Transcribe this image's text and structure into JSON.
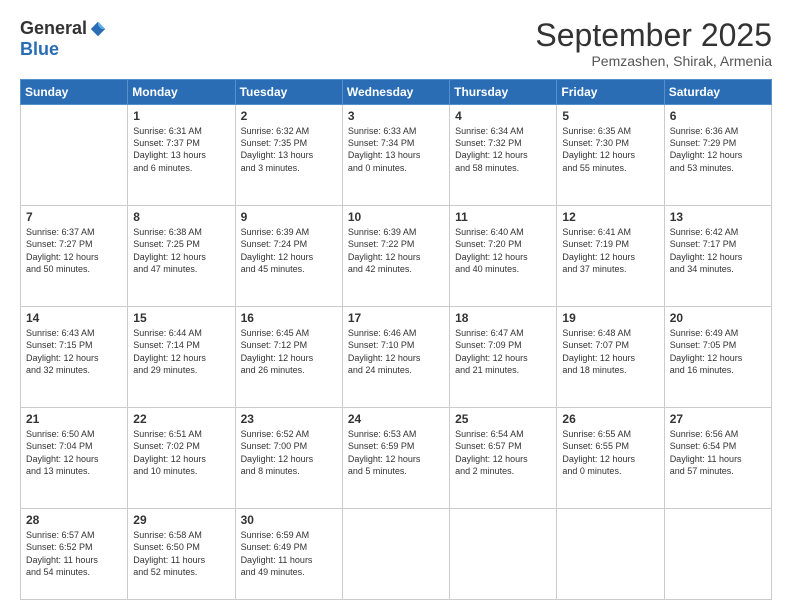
{
  "logo": {
    "general": "General",
    "blue": "Blue"
  },
  "header": {
    "month": "September 2025",
    "location": "Pemzashen, Shirak, Armenia"
  },
  "weekdays": [
    "Sunday",
    "Monday",
    "Tuesday",
    "Wednesday",
    "Thursday",
    "Friday",
    "Saturday"
  ],
  "weeks": [
    [
      {
        "day": "",
        "info": ""
      },
      {
        "day": "1",
        "info": "Sunrise: 6:31 AM\nSunset: 7:37 PM\nDaylight: 13 hours\nand 6 minutes."
      },
      {
        "day": "2",
        "info": "Sunrise: 6:32 AM\nSunset: 7:35 PM\nDaylight: 13 hours\nand 3 minutes."
      },
      {
        "day": "3",
        "info": "Sunrise: 6:33 AM\nSunset: 7:34 PM\nDaylight: 13 hours\nand 0 minutes."
      },
      {
        "day": "4",
        "info": "Sunrise: 6:34 AM\nSunset: 7:32 PM\nDaylight: 12 hours\nand 58 minutes."
      },
      {
        "day": "5",
        "info": "Sunrise: 6:35 AM\nSunset: 7:30 PM\nDaylight: 12 hours\nand 55 minutes."
      },
      {
        "day": "6",
        "info": "Sunrise: 6:36 AM\nSunset: 7:29 PM\nDaylight: 12 hours\nand 53 minutes."
      }
    ],
    [
      {
        "day": "7",
        "info": "Sunrise: 6:37 AM\nSunset: 7:27 PM\nDaylight: 12 hours\nand 50 minutes."
      },
      {
        "day": "8",
        "info": "Sunrise: 6:38 AM\nSunset: 7:25 PM\nDaylight: 12 hours\nand 47 minutes."
      },
      {
        "day": "9",
        "info": "Sunrise: 6:39 AM\nSunset: 7:24 PM\nDaylight: 12 hours\nand 45 minutes."
      },
      {
        "day": "10",
        "info": "Sunrise: 6:39 AM\nSunset: 7:22 PM\nDaylight: 12 hours\nand 42 minutes."
      },
      {
        "day": "11",
        "info": "Sunrise: 6:40 AM\nSunset: 7:20 PM\nDaylight: 12 hours\nand 40 minutes."
      },
      {
        "day": "12",
        "info": "Sunrise: 6:41 AM\nSunset: 7:19 PM\nDaylight: 12 hours\nand 37 minutes."
      },
      {
        "day": "13",
        "info": "Sunrise: 6:42 AM\nSunset: 7:17 PM\nDaylight: 12 hours\nand 34 minutes."
      }
    ],
    [
      {
        "day": "14",
        "info": "Sunrise: 6:43 AM\nSunset: 7:15 PM\nDaylight: 12 hours\nand 32 minutes."
      },
      {
        "day": "15",
        "info": "Sunrise: 6:44 AM\nSunset: 7:14 PM\nDaylight: 12 hours\nand 29 minutes."
      },
      {
        "day": "16",
        "info": "Sunrise: 6:45 AM\nSunset: 7:12 PM\nDaylight: 12 hours\nand 26 minutes."
      },
      {
        "day": "17",
        "info": "Sunrise: 6:46 AM\nSunset: 7:10 PM\nDaylight: 12 hours\nand 24 minutes."
      },
      {
        "day": "18",
        "info": "Sunrise: 6:47 AM\nSunset: 7:09 PM\nDaylight: 12 hours\nand 21 minutes."
      },
      {
        "day": "19",
        "info": "Sunrise: 6:48 AM\nSunset: 7:07 PM\nDaylight: 12 hours\nand 18 minutes."
      },
      {
        "day": "20",
        "info": "Sunrise: 6:49 AM\nSunset: 7:05 PM\nDaylight: 12 hours\nand 16 minutes."
      }
    ],
    [
      {
        "day": "21",
        "info": "Sunrise: 6:50 AM\nSunset: 7:04 PM\nDaylight: 12 hours\nand 13 minutes."
      },
      {
        "day": "22",
        "info": "Sunrise: 6:51 AM\nSunset: 7:02 PM\nDaylight: 12 hours\nand 10 minutes."
      },
      {
        "day": "23",
        "info": "Sunrise: 6:52 AM\nSunset: 7:00 PM\nDaylight: 12 hours\nand 8 minutes."
      },
      {
        "day": "24",
        "info": "Sunrise: 6:53 AM\nSunset: 6:59 PM\nDaylight: 12 hours\nand 5 minutes."
      },
      {
        "day": "25",
        "info": "Sunrise: 6:54 AM\nSunset: 6:57 PM\nDaylight: 12 hours\nand 2 minutes."
      },
      {
        "day": "26",
        "info": "Sunrise: 6:55 AM\nSunset: 6:55 PM\nDaylight: 12 hours\nand 0 minutes."
      },
      {
        "day": "27",
        "info": "Sunrise: 6:56 AM\nSunset: 6:54 PM\nDaylight: 11 hours\nand 57 minutes."
      }
    ],
    [
      {
        "day": "28",
        "info": "Sunrise: 6:57 AM\nSunset: 6:52 PM\nDaylight: 11 hours\nand 54 minutes."
      },
      {
        "day": "29",
        "info": "Sunrise: 6:58 AM\nSunset: 6:50 PM\nDaylight: 11 hours\nand 52 minutes."
      },
      {
        "day": "30",
        "info": "Sunrise: 6:59 AM\nSunset: 6:49 PM\nDaylight: 11 hours\nand 49 minutes."
      },
      {
        "day": "",
        "info": ""
      },
      {
        "day": "",
        "info": ""
      },
      {
        "day": "",
        "info": ""
      },
      {
        "day": "",
        "info": ""
      }
    ]
  ]
}
